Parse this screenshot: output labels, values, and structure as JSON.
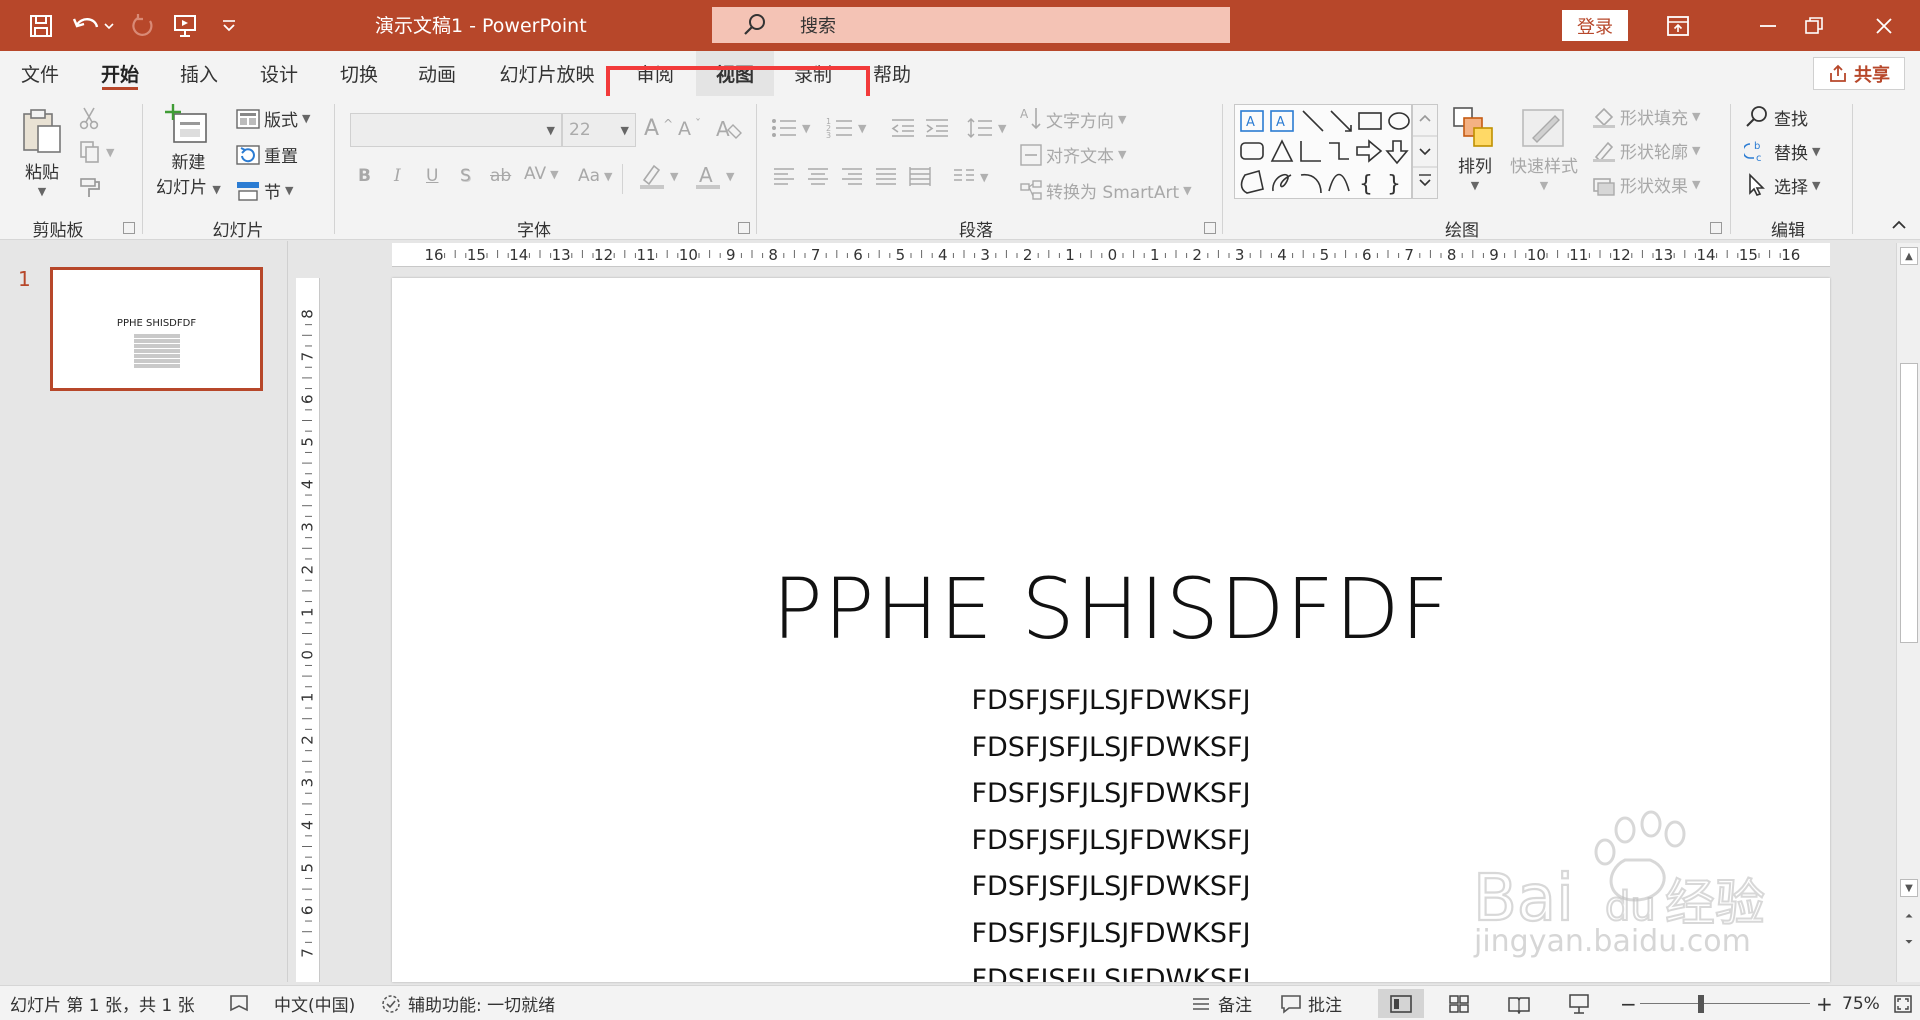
{
  "app": {
    "document_title": "演示文稿1  -  PowerPoint",
    "search_placeholder": "搜索",
    "login_label": "登录",
    "share_label": "共享",
    "accent": "#b7472a"
  },
  "tabs": [
    {
      "label": "文件"
    },
    {
      "label": "开始"
    },
    {
      "label": "插入"
    },
    {
      "label": "设计"
    },
    {
      "label": "切换"
    },
    {
      "label": "动画"
    },
    {
      "label": "幻灯片放映"
    },
    {
      "label": "审阅"
    },
    {
      "label": "视图"
    },
    {
      "label": "录制"
    },
    {
      "label": "帮助"
    }
  ],
  "ribbon": {
    "clipboard": {
      "group": "剪贴板",
      "paste": "粘贴"
    },
    "slides": {
      "group": "幻灯片",
      "new_slide_1": "新建",
      "new_slide_2": "幻灯片",
      "layout": "版式",
      "reset": "重置",
      "section": "节"
    },
    "font": {
      "group": "字体",
      "size": "22",
      "bold": "B",
      "italic": "I",
      "underline": "U",
      "shadow": "S",
      "strike": "ab",
      "spacing": "AV",
      "case": "Aa"
    },
    "paragraph": {
      "group": "段落",
      "text_direction": "文字方向",
      "align_text": "对齐文本",
      "smartart": "转换为 SmartArt"
    },
    "drawing": {
      "group": "绘图",
      "arrange": "排列",
      "quick_styles": "快速样式",
      "fill": "形状填充",
      "outline": "形状轮廓",
      "effects": "形状效果"
    },
    "editing": {
      "group": "编辑",
      "find": "查找",
      "replace": "替换",
      "select": "选择"
    }
  },
  "thumbnail": {
    "number": "1",
    "title": "PPHE SHISDFDF"
  },
  "ruler": {
    "h_ticks": [
      "16",
      "15",
      "14",
      "13",
      "12",
      "11",
      "10",
      "9",
      "8",
      "7",
      "6",
      "5",
      "4",
      "3",
      "2",
      "1",
      "0",
      "1",
      "2",
      "3",
      "4",
      "5",
      "6",
      "7",
      "8",
      "9",
      "10",
      "11",
      "12",
      "13",
      "14",
      "15",
      "16"
    ],
    "v_ticks": [
      "8",
      "7",
      "6",
      "5",
      "4",
      "3",
      "2",
      "1",
      "0",
      "1",
      "2",
      "3",
      "4",
      "5",
      "6",
      "7"
    ]
  },
  "slide": {
    "title": "PPHE SHISDFDF",
    "lines": [
      "FDSFJSFJLSJFDWKSFJ",
      "FDSFJSFJLSJFDWKSFJ",
      "FDSFJSFJLSJFDWKSFJ",
      "FDSFJSFJLSJFDWKSFJ",
      "FDSFJSFJLSJFDWKSFJ",
      "FDSFJSFJLSJFDWKSFJ",
      "FDSFJSFJLSJFDWKSFJ"
    ]
  },
  "statusbar": {
    "slide_info": "幻灯片 第 1 张，共 1 张",
    "language": "中文(中国)",
    "accessibility": "辅助功能: 一切就绪",
    "notes": "备注",
    "comments": "批注",
    "zoom": "75%",
    "zoom_level_percent": 75
  },
  "watermark": {
    "brand": "Bai du 经验",
    "url": "jingyan.baidu.com"
  }
}
